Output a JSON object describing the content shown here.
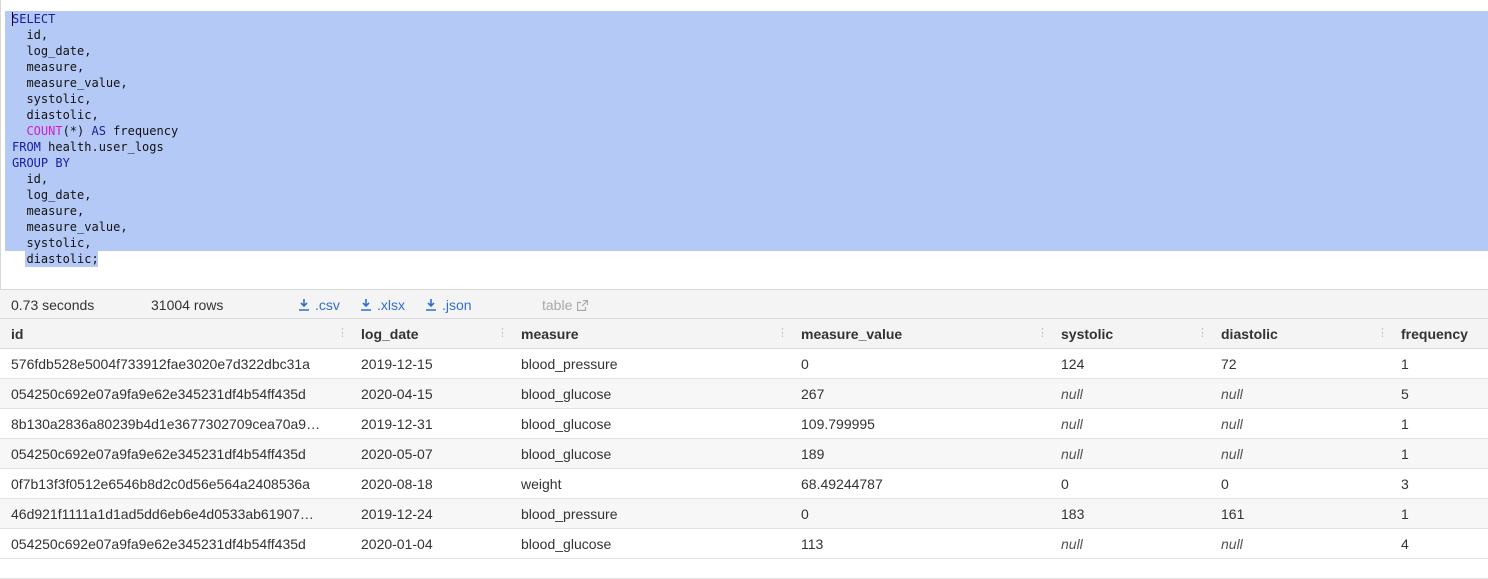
{
  "editor": {
    "lines": [
      {
        "parts": [
          {
            "t": "SELECT",
            "k": "kw"
          }
        ]
      },
      {
        "parts": [
          {
            "t": "  id,",
            "k": ""
          }
        ]
      },
      {
        "parts": [
          {
            "t": "  log_date,",
            "k": ""
          }
        ]
      },
      {
        "parts": [
          {
            "t": "  measure,",
            "k": ""
          }
        ]
      },
      {
        "parts": [
          {
            "t": "  measure_value,",
            "k": ""
          }
        ]
      },
      {
        "parts": [
          {
            "t": "  systolic,",
            "k": ""
          }
        ]
      },
      {
        "parts": [
          {
            "t": "  diastolic,",
            "k": ""
          }
        ]
      },
      {
        "parts": [
          {
            "t": "  ",
            "k": ""
          },
          {
            "t": "COUNT",
            "k": "fn"
          },
          {
            "t": "(*) ",
            "k": ""
          },
          {
            "t": "AS",
            "k": "kw"
          },
          {
            "t": " frequency",
            "k": ""
          }
        ]
      },
      {
        "parts": [
          {
            "t": "FROM",
            "k": "kw"
          },
          {
            "t": " health.user_logs",
            "k": ""
          }
        ]
      },
      {
        "parts": [
          {
            "t": "GROUP BY",
            "k": "kw"
          }
        ]
      },
      {
        "parts": [
          {
            "t": "  id,",
            "k": ""
          }
        ]
      },
      {
        "parts": [
          {
            "t": "  log_date,",
            "k": ""
          }
        ]
      },
      {
        "parts": [
          {
            "t": "  measure,",
            "k": ""
          }
        ]
      },
      {
        "parts": [
          {
            "t": "  measure_value,",
            "k": ""
          }
        ]
      },
      {
        "parts": [
          {
            "t": "  systolic,",
            "k": ""
          }
        ]
      },
      {
        "parts": [
          {
            "t": "  diastolic;",
            "k": ""
          }
        ]
      }
    ],
    "colors": {
      "keyword": "#1a1aa6",
      "function": "#d11cd1",
      "selection": "#b4c9f6"
    }
  },
  "results": {
    "time": "0.73 seconds",
    "rows": "31004 rows",
    "downloads": {
      "csv": ".csv",
      "xlsx": ".xlsx",
      "json": ".json"
    },
    "table_link": "table",
    "download_icon": "download-icon",
    "external_icon": "external-link-icon"
  },
  "table": {
    "columns": [
      "id",
      "log_date",
      "measure",
      "measure_value",
      "systolic",
      "diastolic",
      "frequency"
    ],
    "rows": [
      [
        "576fdb528e5004f733912fae3020e7d322dbc31a",
        "2019-12-15",
        "blood_pressure",
        "0",
        "124",
        "72",
        "1"
      ],
      [
        "054250c692e07a9fa9e62e345231df4b54ff435d",
        "2020-04-15",
        "blood_glucose",
        "267",
        "null",
        "null",
        "5"
      ],
      [
        "8b130a2836a80239b4d1e3677302709cea70a9…",
        "2019-12-31",
        "blood_glucose",
        "109.799995",
        "null",
        "null",
        "1"
      ],
      [
        "054250c692e07a9fa9e62e345231df4b54ff435d",
        "2020-05-07",
        "blood_glucose",
        "189",
        "null",
        "null",
        "1"
      ],
      [
        "0f7b13f3f0512e6546b8d2c0d56e564a2408536a",
        "2020-08-18",
        "weight",
        "68.49244787",
        "0",
        "0",
        "3"
      ],
      [
        "46d921f1111a1d1ad5dd6eb6e4d0533ab61907…",
        "2019-12-24",
        "blood_pressure",
        "0",
        "183",
        "161",
        "1"
      ],
      [
        "054250c692e07a9fa9e62e345231df4b54ff435d",
        "2020-01-04",
        "blood_glucose",
        "113",
        "null",
        "null",
        "4"
      ]
    ]
  }
}
